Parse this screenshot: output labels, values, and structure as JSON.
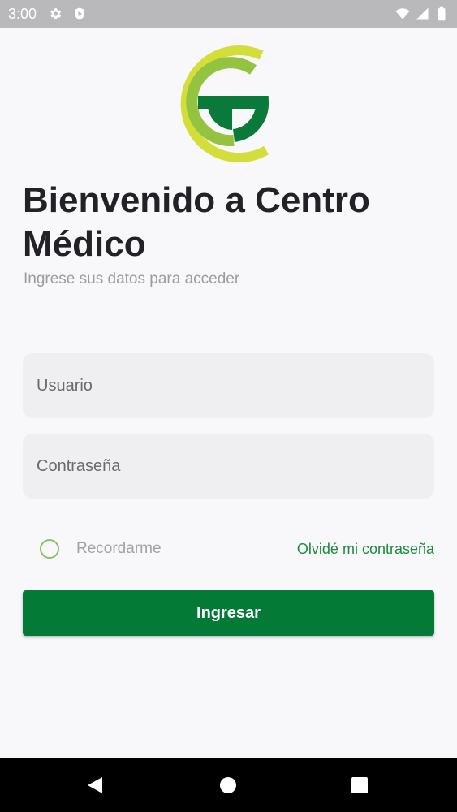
{
  "status_bar": {
    "time": "3:00",
    "left_icons": [
      "gear-icon",
      "shield-icon"
    ],
    "right_icons": [
      "wifi-icon",
      "signal-icon",
      "battery-icon"
    ]
  },
  "logo": {
    "colors": [
      "#d4de3b",
      "#93c340",
      "#0a7a3a"
    ]
  },
  "welcome": {
    "title": "Bienvenido a Centro Médico",
    "subtitle": "Ingrese sus datos para acceder"
  },
  "form": {
    "username": {
      "placeholder": "Usuario",
      "value": ""
    },
    "password": {
      "placeholder": "Contraseña",
      "value": ""
    },
    "remember_label": "Recordarme",
    "remember_checked": false,
    "forgot_label": "Olvidé mi contraseña",
    "submit_label": "Ingresar"
  },
  "colors": {
    "primary": "#037a36",
    "link": "#1c8a3e",
    "field_bg": "#efeef1",
    "background": "#f8f8fa",
    "status_bar": "#b9b9bb",
    "nav_bar": "#000000"
  },
  "nav_bar": {
    "buttons": [
      "back-icon",
      "home-icon",
      "recents-icon"
    ]
  }
}
